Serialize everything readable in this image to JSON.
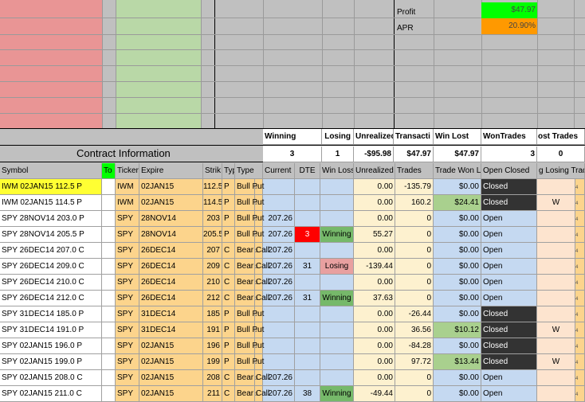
{
  "summary": {
    "profit_label": "Profit",
    "profit_value": "$47.97",
    "apr_label": "APR",
    "apr_value": "20.90%"
  },
  "stats_headers": {
    "winning": "Winning",
    "losing": "Losing",
    "unrealized": "Unrealized",
    "transactions": "Transacti",
    "win_lost": "Win Lost",
    "won_trades": "WonTrades",
    "lost_trades": "ost Trades"
  },
  "stats_values": {
    "winning": "3",
    "losing": "1",
    "unrealized": "-$95.98",
    "transactions": "$47.97",
    "win_lost": "$47.97",
    "won_trades": "3",
    "lost_trades": "0"
  },
  "contract_info_label": "Contract Information",
  "columns": {
    "symbol": "Symbol",
    "to": "To",
    "ticker": "Ticker",
    "expire": "Expire",
    "strike": "Strik",
    "typ": "Typ",
    "type": "Type",
    "current": "Current",
    "dte": "DTE",
    "win_loss": "Win Loss",
    "unrealized": "Unrealized",
    "trades": "Trades",
    "trade_won": "Trade Won L",
    "open_closed": "Open Closed",
    "losing_trade": "g Losing Trad"
  },
  "rows": [
    {
      "symbol": "IWM 02JAN15 112.5 P",
      "ticker": "IWM",
      "expire": "02JAN15",
      "strike": "112.5",
      "typ": "P",
      "type": "Bull Put",
      "current": "",
      "dte": "",
      "win_loss": "",
      "unrealized": "0.00",
      "trades": "-135.79",
      "trade_won": "$0.00",
      "status": "Closed",
      "losing": ""
    },
    {
      "symbol": "IWM 02JAN15 114.5 P",
      "ticker": "IWM",
      "expire": "02JAN15",
      "strike": "114.5",
      "typ": "P",
      "type": "Bull Put",
      "current": "",
      "dte": "",
      "win_loss": "",
      "unrealized": "0.00",
      "trades": "160.2",
      "trade_won": "$24.41",
      "status": "Closed",
      "losing": "W"
    },
    {
      "symbol": "SPY 28NOV14 203.0 P",
      "ticker": "SPY",
      "expire": "28NOV14",
      "strike": "203",
      "typ": "P",
      "type": "Bull Put",
      "current": "207.26",
      "dte": "",
      "win_loss": "",
      "unrealized": "0.00",
      "trades": "0",
      "trade_won": "$0.00",
      "status": "Open",
      "losing": ""
    },
    {
      "symbol": "SPY 28NOV14 205.5 P",
      "ticker": "SPY",
      "expire": "28NOV14",
      "strike": "205.5",
      "typ": "P",
      "type": "Bull Put",
      "current": "207.26",
      "dte": "3",
      "win_loss": "Winning",
      "unrealized": "55.27",
      "trades": "0",
      "trade_won": "$0.00",
      "status": "Open",
      "losing": ""
    },
    {
      "symbol": "SPY 26DEC14 207.0 C",
      "ticker": "SPY",
      "expire": "26DEC14",
      "strike": "207",
      "typ": "C",
      "type": "Bear Call",
      "current": "207.26",
      "dte": "",
      "win_loss": "",
      "unrealized": "0.00",
      "trades": "0",
      "trade_won": "$0.00",
      "status": "Open",
      "losing": ""
    },
    {
      "symbol": "SPY 26DEC14 209.0 C",
      "ticker": "SPY",
      "expire": "26DEC14",
      "strike": "209",
      "typ": "C",
      "type": "Bear Call",
      "current": "207.26",
      "dte": "31",
      "win_loss": "Losing",
      "unrealized": "-139.44",
      "trades": "0",
      "trade_won": "$0.00",
      "status": "Open",
      "losing": ""
    },
    {
      "symbol": "SPY 26DEC14 210.0 C",
      "ticker": "SPY",
      "expire": "26DEC14",
      "strike": "210",
      "typ": "C",
      "type": "Bear Call",
      "current": "207.26",
      "dte": "",
      "win_loss": "",
      "unrealized": "0.00",
      "trades": "0",
      "trade_won": "$0.00",
      "status": "Open",
      "losing": ""
    },
    {
      "symbol": "SPY 26DEC14 212.0 C",
      "ticker": "SPY",
      "expire": "26DEC14",
      "strike": "212",
      "typ": "C",
      "type": "Bear Call",
      "current": "207.26",
      "dte": "31",
      "win_loss": "Winning",
      "unrealized": "37.63",
      "trades": "0",
      "trade_won": "$0.00",
      "status": "Open",
      "losing": ""
    },
    {
      "symbol": "SPY 31DEC14 185.0 P",
      "ticker": "SPY",
      "expire": "31DEC14",
      "strike": "185",
      "typ": "P",
      "type": "Bull Put",
      "current": "",
      "dte": "",
      "win_loss": "",
      "unrealized": "0.00",
      "trades": "-26.44",
      "trade_won": "$0.00",
      "status": "Closed",
      "losing": ""
    },
    {
      "symbol": "SPY 31DEC14 191.0 P",
      "ticker": "SPY",
      "expire": "31DEC14",
      "strike": "191",
      "typ": "P",
      "type": "Bull Put",
      "current": "",
      "dte": "",
      "win_loss": "",
      "unrealized": "0.00",
      "trades": "36.56",
      "trade_won": "$10.12",
      "status": "Closed",
      "losing": "W"
    },
    {
      "symbol": "SPY 02JAN15 196.0 P",
      "ticker": "SPY",
      "expire": "02JAN15",
      "strike": "196",
      "typ": "P",
      "type": "Bull Put",
      "current": "",
      "dte": "",
      "win_loss": "",
      "unrealized": "0.00",
      "trades": "-84.28",
      "trade_won": "$0.00",
      "status": "Closed",
      "losing": ""
    },
    {
      "symbol": "SPY 02JAN15 199.0 P",
      "ticker": "SPY",
      "expire": "02JAN15",
      "strike": "199",
      "typ": "P",
      "type": "Bull Put",
      "current": "",
      "dte": "",
      "win_loss": "",
      "unrealized": "0.00",
      "trades": "97.72",
      "trade_won": "$13.44",
      "status": "Closed",
      "losing": "W"
    },
    {
      "symbol": "SPY 02JAN15 208.0 C",
      "ticker": "SPY",
      "expire": "02JAN15",
      "strike": "208",
      "typ": "C",
      "type": "Bear Call",
      "current": "207.26",
      "dte": "",
      "win_loss": "",
      "unrealized": "0.00",
      "trades": "0",
      "trade_won": "$0.00",
      "status": "Open",
      "losing": ""
    },
    {
      "symbol": "SPY 02JAN15 211.0 C",
      "ticker": "SPY",
      "expire": "02JAN15",
      "strike": "211",
      "typ": "C",
      "type": "Bear Call",
      "current": "207.26",
      "dte": "38",
      "win_loss": "Winning",
      "unrealized": "-49.44",
      "trades": "0",
      "trade_won": "$0.00",
      "status": "Open",
      "losing": ""
    }
  ],
  "colors": {
    "red_area": "#e99595",
    "green_area": "#b9d8a7",
    "profit_green": "#00ff00",
    "apr_orange": "#ff9900",
    "symbol_highlight": "#ffff33",
    "ticker_orange": "#fcd48c",
    "current_blue": "#c5d9f1",
    "unrealized_cream": "#fdf1cf",
    "dte_red": "#ff0000",
    "winning_green": "#76b96a",
    "losing_pink": "#e8a0a0",
    "closed_dark": "#333333"
  }
}
